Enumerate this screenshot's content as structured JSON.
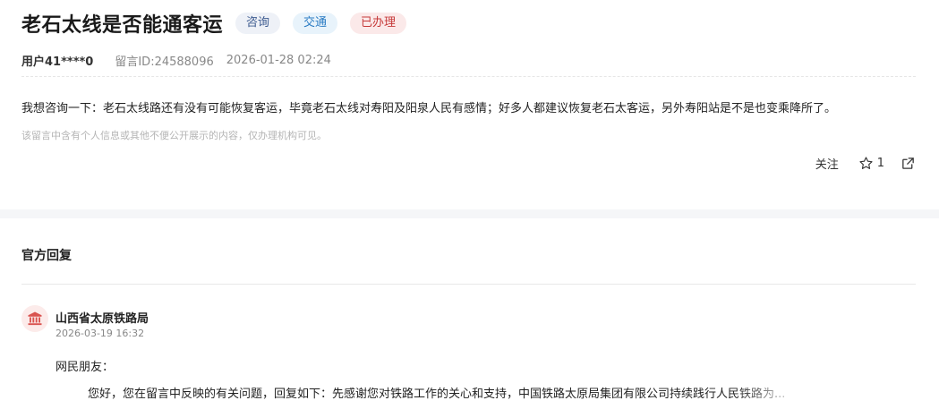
{
  "message": {
    "title": "老石太线是否能通客运",
    "tags": {
      "consult": "咨询",
      "traffic": "交通",
      "status": "已办理"
    },
    "user": "用户41****0",
    "id_label": "留言ID:24588096",
    "datetime": "2026-01-28 02:24",
    "content": "我想咨询一下：老石太线路还有没有可能恢复客运，毕竟老石太线对寿阳及阳泉人民有感情；好多人都建议恢复老石太客运，另外寿阳站是不是也变乘降所了。",
    "privacy_notice": "该留言中含有个人信息或其他不便公开展示的内容，仅办理机构可见。",
    "actions": {
      "follow": "关注",
      "star_count": "1"
    }
  },
  "reply": {
    "heading": "官方回复",
    "org_name": "山西省太原铁路局",
    "datetime": "2026-03-19 16:32",
    "greeting": "网民朋友：",
    "body": "您好，您在留言中反映的有关问题，回复如下：先感谢您对铁路工作的关心和支持，中国铁路太原局集团有限公司持续践行人民铁路为..."
  },
  "colors": {
    "tag_consult": "#3c5a8f",
    "tag_traffic": "#2b7cc4",
    "tag_done": "#c63a3a",
    "org_icon": "#d9534f"
  },
  "icons": {
    "star": "star-icon",
    "share": "share-icon",
    "org": "government-building-icon"
  }
}
